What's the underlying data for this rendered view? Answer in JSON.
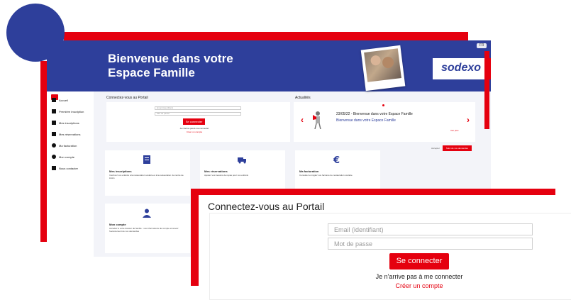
{
  "banner": {
    "title_line1": "Bienvenue dans votre",
    "title_line2": "Espace Famille",
    "top_button": "FR",
    "logo": "sodexo"
  },
  "sidebar": {
    "items": [
      {
        "label": "Accueil",
        "icon": "home-icon"
      },
      {
        "label": "Première inscription",
        "icon": "form-icon"
      },
      {
        "label": "Mes inscriptions",
        "icon": "grid-icon"
      },
      {
        "label": "Mes réservations",
        "icon": "calendar-icon"
      },
      {
        "label": "Ma facturation",
        "icon": "euro-icon"
      },
      {
        "label": "Mon compte",
        "icon": "user-icon"
      },
      {
        "label": "Nous contacter",
        "icon": "mail-icon"
      }
    ]
  },
  "login_small": {
    "title": "Connectez-vous au Portail",
    "email_placeholder": "Email (identifiant)",
    "password_placeholder": "Mot de passe",
    "button": "Se connecter",
    "forgot": "Je n'arrive pas à me connecter",
    "create": "Créer un compte"
  },
  "news": {
    "title": "Actualités",
    "headline": "23/05/22 - Bienvenue dans votre Espace Famille",
    "link": "Bienvenue dans votre Espace Famille",
    "more": "Voir plus"
  },
  "actions": {
    "text": "Accepter",
    "button": "Suivi de vos demandes"
  },
  "tiles": [
    {
      "title": "Mes inscriptions",
      "desc": "Inscrivez vos enfants à la restauration scolaire et à la restauration du centre de loisirs",
      "icon": "form-icon"
    },
    {
      "title": "Mes réservations",
      "desc": "Ajustez vos besoins de repas pour vos enfants",
      "icon": "truck-icon"
    },
    {
      "title": "Ma facturation",
      "desc": "Consultez et réglez vos factures de restauration scolaire",
      "icon": "euro-icon"
    },
    {
      "title": "Mon compte",
      "desc": "Accédez à votre dossier de famille : vos informations de compte et suivez l'avancement de vos demandes",
      "icon": "user-icon"
    }
  ],
  "login": {
    "title": "Connectez-vous au Portail",
    "email_placeholder": "Email (identifiant)",
    "password_placeholder": "Mot de passe",
    "button": "Se connecter",
    "forgot": "Je n'arrive pas à me connecter",
    "create": "Créer un compte"
  },
  "colors": {
    "brand_blue": "#2e3f9b",
    "brand_red": "#e5000f"
  }
}
